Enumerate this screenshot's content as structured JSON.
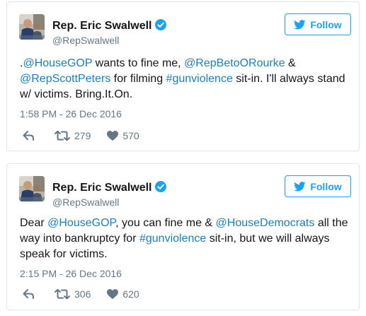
{
  "tweets": [
    {
      "author": {
        "name": "Rep. Eric Swalwell",
        "handle": "@RepSwalwell",
        "verified": true
      },
      "follow_label": "Follow",
      "text": {
        "p0": ".",
        "p1": "@HouseGOP",
        "p2": " wants to fine me, ",
        "p3": "@RepBetoORourke",
        "p4": " & ",
        "p5": "@RepScottPeters",
        "p6": " for filming ",
        "p7": "#gunviolence",
        "p8": " sit-in. I'll always stand w/ victims. Bring.It.On."
      },
      "timestamp": "1:58 PM - 26 Dec 2016",
      "retweets": "279",
      "likes": "570"
    },
    {
      "author": {
        "name": "Rep. Eric Swalwell",
        "handle": "@RepSwalwell",
        "verified": true
      },
      "follow_label": "Follow",
      "text": {
        "p0": "Dear ",
        "p1": "@HouseGOP",
        "p2": ", you can fine me & ",
        "p3": "@HouseDemocrats",
        "p4": " all the way into bankruptcy for ",
        "p5": "#gunviolence",
        "p6": " sit-in, but we will always speak for victims."
      },
      "timestamp": "2:15 PM - 26 Dec 2016",
      "retweets": "306",
      "likes": "620"
    }
  ],
  "colors": {
    "link": "#1b7fbd",
    "follow": "#1da1f2",
    "verified": "#1da1f2",
    "meta": "#657786",
    "border": "#e1e8ed"
  },
  "icons": [
    "avatar-photo",
    "verified-badge-icon",
    "twitter-bird-icon",
    "reply-icon",
    "retweet-icon",
    "heart-icon"
  ]
}
